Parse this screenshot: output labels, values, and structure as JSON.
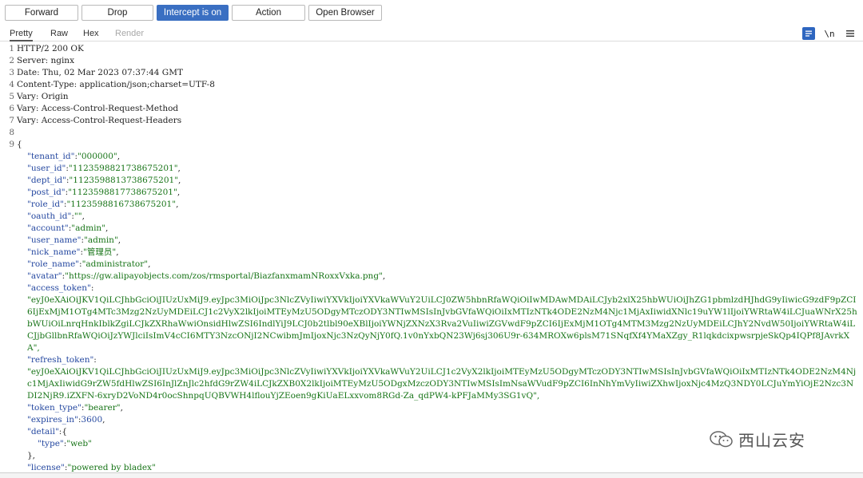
{
  "toolbar": {
    "forward": "Forward",
    "drop": "Drop",
    "intercept": "Intercept is on",
    "action": "Action",
    "open_browser": "Open Browser"
  },
  "tabs": {
    "pretty": "Pretty",
    "raw": "Raw",
    "hex": "Hex",
    "render": "Render",
    "newline_toggle": "\\n"
  },
  "response": {
    "headers": [
      "HTTP/2 200 OK",
      "Server: nginx",
      "Date: Thu, 02 Mar 2023 07:37:44 GMT",
      "Content-Type: application/json;charset=UTF-8",
      "Vary: Origin",
      "Vary: Access-Control-Request-Method",
      "Vary: Access-Control-Request-Headers"
    ],
    "line_numbers": [
      "1",
      "2",
      "3",
      "4",
      "5",
      "6",
      "7",
      "8",
      "9"
    ],
    "body": {
      "tenant_id": "000000",
      "user_id": "1123598821738675201",
      "dept_id": "1123598813738675201",
      "post_id": "1123598817738675201",
      "role_id": "1123598816738675201",
      "oauth_id": "",
      "account": "admin",
      "user_name": "admin",
      "nick_name": "管理员",
      "role_name": "administrator",
      "avatar": "https://gw.alipayobjects.com/zos/rmsportal/BiazfanxmamNRoxxVxka.png",
      "access_token": "eyJ0eXAiOiJKV1QiLCJhbGciOiJIUzUxMiJ9.eyJpc3MiOiJpc3NlcZVyIiwiYXVkIjoiYXVkaWVuY2UiLCJ0ZW5hbnRfaWQiOiIwMDAwMDAiLCJyb2xlX25hbWUiOiJhZG1pbmlzdHJhdG9yIiwicG9zdF9pZCI6IjExMjM1OTg4MTc3Mzg2NzUyMDEiLCJ1c2VyX2lkIjoiMTEyMzU5ODgyMTczODY3NTIwMSIsInJvbGVfaWQiOiIxMTIzNTk4ODE2NzM4Njc1MjAxIiwidXNlc19uYW1lIjoiYWRtaW4iLCJuaWNrX25hbWUiOiLnrqHnkIblkZgiLCJkZXRhaWwiOnsidHlwZSI6IndlYiJ9LCJ0b2tlbl90eXBlIjoiYWNjZXNzX3Rva2VuIiwiZGVwdF9pZCI6IjExMjM1OTg4MTM3Mzg2NzUyMDEiLCJhY2NvdW50IjoiYWRtaW4iLCJjbGllbnRfaWQiOiJzYWJlciIsImV4cCI6MTY3NzcONjI2NCwibmJmIjoxNjc3NzQyNjY0fQ.1v0nYxbQN23Wj6sj306U9r-634MROXw6plsM71SNqfXf4YMaXZgy_R1lqkdcixpwsrpjeSkQp4IQPf8JAvrkXA",
      "refresh_token": "eyJ0eXAiOiJKV1QiLCJhbGciOiJIUzUxMiJ9.eyJpc3MiOiJpc3NlcZVyIiwiYXVkIjoiYXVkaWVuY2UiLCJ1c2VyX2lkIjoiMTEyMzU5ODgyMTczODY3NTIwMSIsInJvbGVfaWQiOiIxMTIzNTk4ODE2NzM4Njc1MjAxIiwidG9rZW5fdHlwZSI6InJlZnJlc2hfdG9rZW4iLCJkZXB0X2lkIjoiMTEyMzU5ODgxMzczODY3NTIwMSIsImNsaWVudF9pZCI6InNhYmVyIiwiZXhwIjoxNjc4MzQ3NDY0LCJuYmYiOjE2Nzc3NDI2NjR9.iZXFN-6xryD2VoND4r0ocShnpqUQBVWH4lflouYjZEoen9gKiUaELxxvom8RGd-Za_qdPW4-kPFJaMMy3SG1vQ",
      "token_type": "bearer",
      "expires_in": "3600",
      "detail_type": "web",
      "license": "powered by bladex"
    }
  },
  "watermark": {
    "text": "西山云安"
  },
  "colors": {
    "accent": "#3a6fc2",
    "key": "#2548a0",
    "string": "#177417"
  },
  "icons": {
    "pretty_toggle": "word-wrap-icon",
    "newline": "newline-icon",
    "menu": "hamburger-menu-icon",
    "watermark_logo": "wechat-logo-icon"
  }
}
